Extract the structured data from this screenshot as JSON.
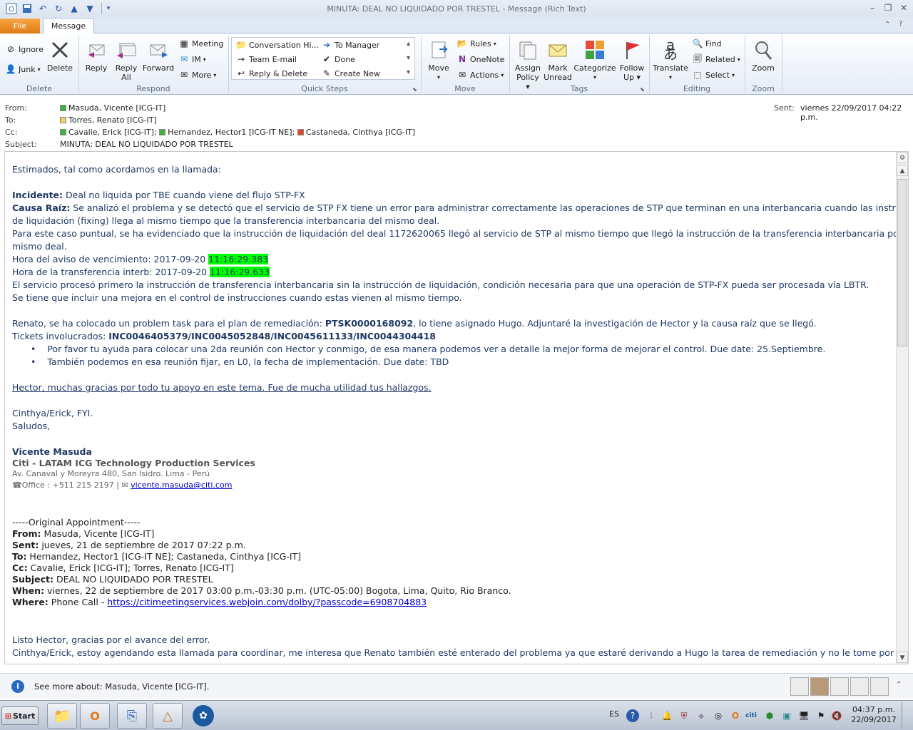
{
  "window": {
    "title": "MINUTA: DEAL NO LIQUIDADO POR TRESTEL  - Message (Rich Text)"
  },
  "tabs": {
    "file": "File",
    "message": "Message"
  },
  "ribbon": {
    "delete_group": {
      "label": "Delete",
      "ignore": "Ignore",
      "junk": "Junk",
      "delete": "Delete"
    },
    "respond_group": {
      "label": "Respond",
      "reply": "Reply",
      "reply_all_1": "Reply",
      "reply_all_2": "All",
      "forward": "Forward",
      "meeting": "Meeting",
      "im": "IM",
      "more": "More"
    },
    "quicksteps_group": {
      "label": "Quick Steps",
      "items": [
        "Conversation Hi...",
        "Team E-mail",
        "Reply & Delete",
        "To Manager",
        "Done",
        "Create New"
      ]
    },
    "move_group": {
      "label": "Move",
      "move": "Move",
      "rules": "Rules",
      "onenote": "OneNote",
      "actions": "Actions"
    },
    "tags_group": {
      "label": "Tags",
      "assign_policy_1": "Assign",
      "assign_policy_2": "Policy",
      "mark_unread_1": "Mark",
      "mark_unread_2": "Unread",
      "categorize": "Categorize",
      "follow_up_1": "Follow",
      "follow_up_2": "Up"
    },
    "editing_group": {
      "label": "Editing",
      "translate": "Translate",
      "find": "Find",
      "related": "Related",
      "select": "Select"
    },
    "zoom_group": {
      "label": "Zoom",
      "zoom": "Zoom"
    }
  },
  "header": {
    "from_label": "From:",
    "from": "Masuda, Vicente [ICG-IT]",
    "to_label": "To:",
    "to": "Torres, Renato [ICG-IT]",
    "cc_label": "Cc:",
    "cc_1": "Cavalie, Erick [ICG-IT];",
    "cc_2": "Hernandez, Hector1 [ICG-IT NE];",
    "cc_3": "Castaneda, Cinthya [ICG-IT]",
    "subject_label": "Subject:",
    "subject": "MINUTA: DEAL NO LIQUIDADO POR TRESTEL",
    "sent_label": "Sent:",
    "sent": "viernes 22/09/2017 04:22 p.m."
  },
  "body": {
    "greeting": "Estimados, tal como acordamos en la llamada:",
    "incidente_label": "Incidente:",
    "incidente": " Deal no liquida por TBE cuando viene del flujo STP-FX",
    "causa_label": "Causa Raíz:",
    "causa_1": " Se analizó el problema y se detectó que el servicio de STP FX tiene un error para administrar correctamente las operaciones de STP que terminan en una interbancaria cuando las instrucciones",
    "causa_2": "de liquidación (fixing) llega al mismo tiempo que la transferencia interbancaria del mismo deal.",
    "caso_1": "Para este caso puntual, se ha evidenciado que la instrucción de liquidación del deal 1172620065 llegó al servicio de STP al mismo tiempo que llegó la instrucción de la transferencia interbancaria por ese",
    "caso_2": "mismo deal.",
    "hora1_label": "Hora del aviso de vencimiento: 2017-09-20 ",
    "hora1_time": "11:16:29.383",
    "hora2_label": "Hora de la transferencia interb: 2017-09-20 ",
    "hora2_time": "11:16:29.633",
    "servicio": "El servicio procesó primero la instrucción de transferencia interbancaria sin la instrucción de liquidación, condición necesaria para que una operación de STP-FX pueda ser procesada vía LBTR.",
    "mejora": "Se tiene que incluir una mejora en el control de instrucciones cuando estas vienen al mismo tiempo.",
    "renato_1": "Renato, se ha colocado un problem task para el plan de remediación: ",
    "renato_ptsk": "PTSK0000168092",
    "renato_2": ", lo tiene asignado Hugo. Adjuntaré la investigación de Hector y la causa raíz que se llegó.",
    "tickets_label": "Tickets involucrados: ",
    "tickets": "INC0046405379/INC0045052848/INC0045611133/INC0044304418",
    "bullet_1": "Por favor tu ayuda para colocar una 2da reunión con Hector y conmigo, de esa manera podemos ver a detalle la mejor forma de mejorar el control. Due date: 25.Septiembre.",
    "bullet_2": "También podemos en esa reunión fijar, en L0, la fecha de implementación. Due date: TBD",
    "hector": "Hector, muchas gracias por todo tu apoyo en este tema. Fue de mucha utilidad tus hallazgos.",
    "fyi": "Cinthya/Erick, FYI.",
    "saludos": "Saludos,",
    "sig_name": "Vicente Masuda",
    "sig_company": "Citi - LATAM ICG Technology Production Services",
    "sig_address": "Av. Canaval y Moreyra 480, San Isidro.  Lima - Perú",
    "sig_phone": "Office  : +511 215 2197 |",
    "sig_email": "vicente.masuda@citi.com",
    "orig_header": "-----Original Appointment-----",
    "orig_from_label": "From:",
    "orig_from": " Masuda, Vicente [ICG-IT]",
    "orig_sent_label": "Sent:",
    "orig_sent": " jueves, 21 de septiembre de 2017 07:22 p.m.",
    "orig_to_label": "To:",
    "orig_to": " Hernandez, Hector1 [ICG-IT NE]; Castaneda, Cinthya [ICG-IT]",
    "orig_cc_label": "Cc:",
    "orig_cc": " Cavalie, Erick [ICG-IT]; Torres, Renato [ICG-IT]",
    "orig_subject_label": "Subject:",
    "orig_subject": " DEAL NO LIQUIDADO POR TRESTEL",
    "orig_when_label": "When:",
    "orig_when": " viernes, 22 de septiembre de 2017 03:00 p.m.-03:30 p.m. (UTC-05:00) Bogota, Lima, Quito, Rio Branco.",
    "orig_where_label": "Where:",
    "orig_where": " Phone Call - ",
    "orig_where_link": "https://citimeetingservices.webjoin.com/dolby/?passcode=6908704883",
    "listo": "Listo Hector, gracias por el avance del error.",
    "cinthya": "Cinthya/Erick, estoy agendando esta llamada para coordinar, me interesa que Renato también esté enterado del problema ya que estaré derivando a Hugo la tarea de remediación y no le tome por"
  },
  "people_pane": {
    "text": "See more about: Masuda, Vicente [ICG-IT]."
  },
  "taskbar": {
    "start": "Start",
    "lang": "ES",
    "time": "04:37 p.m.",
    "date": "22/09/2017"
  },
  "colors": {
    "accent": "#1f3864",
    "highlight": "#00ff00",
    "file_tab": "#e07a12"
  }
}
